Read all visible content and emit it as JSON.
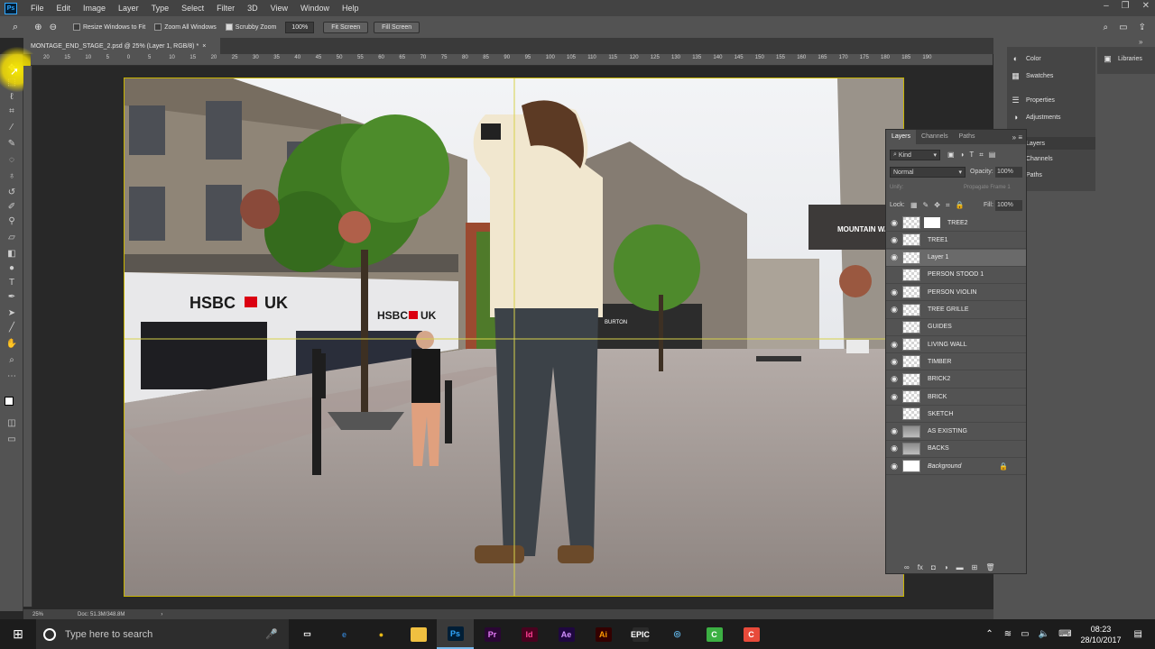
{
  "menu": {
    "logo": "Ps",
    "items": [
      "File",
      "Edit",
      "Image",
      "Layer",
      "Type",
      "Select",
      "Filter",
      "3D",
      "View",
      "Window",
      "Help"
    ]
  },
  "options": {
    "resize_windows": "Resize Windows to Fit",
    "zoom_all": "Zoom All Windows",
    "scrubby_zoom": "Scrubby Zoom",
    "zoom_value": "100%",
    "fit_screen": "Fit Screen",
    "fill_screen": "Fill Screen"
  },
  "document": {
    "tab_title": "MONTAGE_END_STAGE_2.psd @ 25% (Layer 1, RGB/8) *",
    "close_glyph": "×",
    "zoom_status": "25%",
    "doc_status": "Doc: 51.3M/348.8M",
    "ruler_labels": [
      "20",
      "15",
      "10",
      "5",
      "0",
      "5",
      "10",
      "15",
      "20",
      "25",
      "30",
      "35",
      "40",
      "45",
      "50",
      "55",
      "60",
      "65",
      "70",
      "75",
      "80",
      "85",
      "90",
      "95",
      "100",
      "105",
      "110",
      "115",
      "120",
      "125",
      "130",
      "135",
      "140",
      "145",
      "150",
      "155",
      "160",
      "165",
      "170",
      "175",
      "180",
      "185",
      "190"
    ]
  },
  "scene": {
    "bank_sign": "HSBC",
    "bank_sign_suffix": "UK",
    "bank_sign2": "HSBC",
    "bank_sign2_suffix": "UK",
    "store_sign": "MOUNTAIN WAREHOU",
    "shop_sign": "BURTON"
  },
  "right_dock": {
    "col_a": [
      {
        "label": "Color",
        "icon": "color-icon"
      },
      {
        "label": "Swatches",
        "icon": "swatches-icon"
      },
      {
        "label": "Properties",
        "icon": "properties-icon"
      },
      {
        "label": "Adjustments",
        "icon": "adjustments-icon"
      },
      {
        "label": "Layers",
        "icon": "layers-icon"
      },
      {
        "label": "Channels",
        "icon": "channels-icon"
      },
      {
        "label": "Paths",
        "icon": "paths-icon"
      }
    ],
    "libraries": "Libraries"
  },
  "layers_panel": {
    "tabs": [
      "Layers",
      "Channels",
      "Paths"
    ],
    "kind": "Kind",
    "blend_mode": "Normal",
    "opacity_label": "Opacity:",
    "opacity_value": "100%",
    "unify_label": "Unify:",
    "propagate_label": "Propagate Frame 1",
    "lock_label": "Lock:",
    "fill_label": "Fill:",
    "fill_value": "100%",
    "layers": [
      {
        "name": "TREE2",
        "visible": true,
        "thumb": "checker",
        "mask": true
      },
      {
        "name": "TREE1",
        "visible": true,
        "thumb": "checker"
      },
      {
        "name": "Layer 1",
        "visible": true,
        "thumb": "checker",
        "selected": true
      },
      {
        "name": "PERSON STOOD 1",
        "visible": false,
        "thumb": "checker"
      },
      {
        "name": "PERSON VIOLIN",
        "visible": true,
        "thumb": "checker"
      },
      {
        "name": "TREE GRILLE",
        "visible": true,
        "thumb": "checker"
      },
      {
        "name": "GUIDES",
        "visible": false,
        "thumb": "checker"
      },
      {
        "name": "LIVING WALL",
        "visible": true,
        "thumb": "checker"
      },
      {
        "name": "TIMBER",
        "visible": true,
        "thumb": "checker"
      },
      {
        "name": "BRICK2",
        "visible": true,
        "thumb": "checker"
      },
      {
        "name": "BRICK",
        "visible": true,
        "thumb": "checker"
      },
      {
        "name": "SKETCH",
        "visible": false,
        "thumb": "checker"
      },
      {
        "name": "AS EXISTING",
        "visible": true,
        "thumb": "photo"
      },
      {
        "name": "BACKS",
        "visible": true,
        "thumb": "photo"
      },
      {
        "name": "Background",
        "visible": true,
        "thumb": "white",
        "italic": true,
        "locked": true
      }
    ]
  },
  "taskbar": {
    "search_placeholder": "Type here to search",
    "apps": [
      {
        "name": "task-view",
        "label": "▭",
        "color": "#1c1c1c",
        "text": "#ffffff"
      },
      {
        "name": "edge",
        "label": "e",
        "color": "#1c1c1c",
        "text": "#3277bc"
      },
      {
        "name": "chrome",
        "label": "●",
        "color": "#1c1c1c",
        "text": "#e8b816"
      },
      {
        "name": "file-explorer",
        "label": "▬",
        "color": "#f0c040",
        "text": "#f0c040"
      },
      {
        "name": "photoshop",
        "label": "Ps",
        "color": "#001e36",
        "text": "#31a8ff",
        "active": true
      },
      {
        "name": "premiere",
        "label": "Pr",
        "color": "#2a0634",
        "text": "#e77cf9"
      },
      {
        "name": "indesign",
        "label": "Id",
        "color": "#49021f",
        "text": "#ff3f94"
      },
      {
        "name": "after-effects",
        "label": "Ae",
        "color": "#1f0740",
        "text": "#d291ff"
      },
      {
        "name": "illustrator",
        "label": "Ai",
        "color": "#330000",
        "text": "#ff9a00"
      },
      {
        "name": "epic-games",
        "label": "EPIC",
        "color": "#2a2a2a",
        "text": "#ffffff"
      },
      {
        "name": "app-blue",
        "label": "◎",
        "color": "#1c1c1c",
        "text": "#5fb0e0"
      },
      {
        "name": "app-green",
        "label": "C",
        "color": "#3cb043",
        "text": "#ffffff"
      },
      {
        "name": "app-red",
        "label": "C",
        "color": "#e84a3a",
        "text": "#ffffff"
      }
    ],
    "time": "08:23",
    "date": "28/10/2017"
  }
}
